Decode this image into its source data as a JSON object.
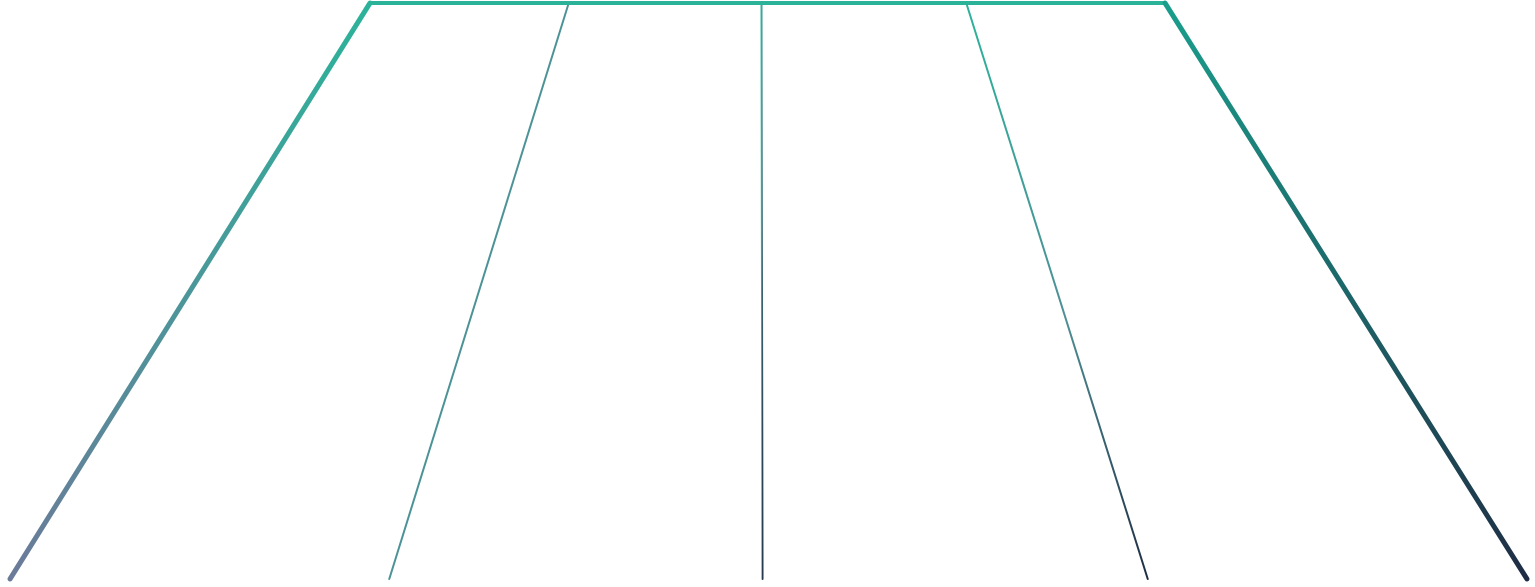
{
  "graphic": {
    "kind": "perspective-grid",
    "columns": 4,
    "rows": 4,
    "colors": {
      "top": "#2bb39a",
      "bottom_left": "#6b7a99",
      "bottom_right": "#1f2d44",
      "background": "#ffffff"
    }
  }
}
